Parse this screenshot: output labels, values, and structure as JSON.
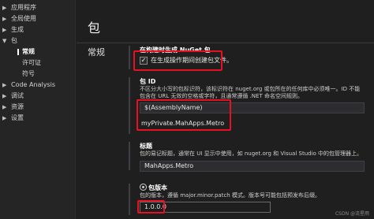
{
  "sidebar": {
    "items": [
      {
        "label": "应用程序",
        "chevron": "▶"
      },
      {
        "label": "全局使用",
        "chevron": "▶"
      },
      {
        "label": "生成",
        "chevron": "▶"
      },
      {
        "label": "包",
        "chevron": "▼"
      },
      {
        "label": "常规"
      },
      {
        "label": "许可证"
      },
      {
        "label": "符号"
      },
      {
        "label": "Code Analysis",
        "chevron": "▶"
      },
      {
        "label": "调试",
        "chevron": "▶"
      },
      {
        "label": "资源",
        "chevron": "▶"
      },
      {
        "label": "设置",
        "chevron": "▶"
      }
    ]
  },
  "page": {
    "title": "包",
    "section": "常规"
  },
  "generate_on_build": {
    "heading": "在构建时生成 NuGet 包",
    "checkbox_label": "在生成操作期间创建包文件。",
    "checked": true,
    "check_mark": "✓"
  },
  "package_id": {
    "name": "包 ID",
    "description_1": "不区分大小写的包标识符，该标识符在 nuget.org 或包所在的任何库中必须唯一。ID 不能",
    "description_2": "包含在 URL 无效的空格或字符，且通常遵循 .NET 命名空间规则。",
    "default_value": "$(AssemblyName)",
    "value": "myPrivate.MahApps.Metro"
  },
  "title_prop": {
    "name": "标题",
    "description": "包的易记标题，通常在 UI 显示中使用，如 nuget.org 和 Visual Studio 中的包管理器上。",
    "value": "MahApps.Metro"
  },
  "version_prop": {
    "name": "包版本",
    "description": "包的版本，遵循 major.minor.patch 模式。版本号可能包括预发布后缀。",
    "value": "1.0.0.0"
  },
  "watermark": "CSDN @流星雨",
  "colors": {
    "highlight": "#e81123",
    "background": "#1f1f1f"
  }
}
